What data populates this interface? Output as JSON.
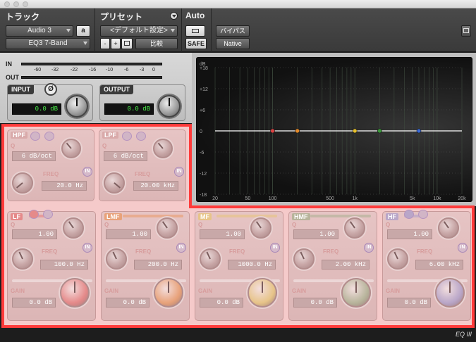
{
  "header": {
    "track_label": "トラック",
    "preset_label": "プリセット",
    "auto_label": "Auto",
    "track_name": "Audio 3",
    "track_variant": "a",
    "plugin_name": "EQ3 7-Band",
    "preset_name": "<デフォルト設定>",
    "minus_label": "-",
    "plus_label": "+",
    "compare_label": "比較",
    "safe_label": "SAFE",
    "bypass_label": "バイパス",
    "native_label": "Native"
  },
  "meters": {
    "in_label": "IN",
    "out_label": "OUT",
    "scale": [
      "-60",
      "-32",
      "-22",
      "-16",
      "-10",
      "-6",
      "-3",
      "0"
    ]
  },
  "input": {
    "label": "INPUT",
    "value": "0.0 dB",
    "phase_label": "Ø"
  },
  "output": {
    "label": "OUTPUT",
    "value": "0.0 dB"
  },
  "graph": {
    "db_label": "dB",
    "y_ticks": [
      "+18",
      "+12",
      "+6",
      "0",
      "-6",
      "-12",
      "-18"
    ],
    "x_ticks": [
      "20",
      "50",
      "100",
      "500",
      "1k",
      "5k",
      "10k",
      "20k"
    ]
  },
  "bands": {
    "hpf": {
      "name": "HPF",
      "q_label": "Q",
      "q_value": "6 dB/oct",
      "freq_label": "FREQ",
      "freq_value": "20.0 Hz",
      "in_label": "IN"
    },
    "lpf": {
      "name": "LPF",
      "q_label": "Q",
      "q_value": "6 dB/oct",
      "freq_label": "FREQ",
      "freq_value": "20.00 kHz",
      "in_label": "IN"
    },
    "lf": {
      "name": "LF",
      "q_label": "Q",
      "q_value": "1.00",
      "freq_label": "FREQ",
      "freq_value": "100.0 Hz",
      "gain_label": "GAIN",
      "gain_value": "0.0 dB",
      "in_label": "IN",
      "color": "#e58a8a"
    },
    "lmf": {
      "name": "LMF",
      "q_label": "Q",
      "q_value": "1.00",
      "freq_label": "FREQ",
      "freq_value": "200.0 Hz",
      "gain_label": "GAIN",
      "gain_value": "0.0 dB",
      "in_label": "IN",
      "color": "#e8a27a"
    },
    "mf": {
      "name": "MF",
      "q_label": "Q",
      "q_value": "1.00",
      "freq_label": "FREQ",
      "freq_value": "1000.0 Hz",
      "gain_label": "GAIN",
      "gain_value": "0.0 dB",
      "in_label": "IN",
      "color": "#e7c489"
    },
    "hmf": {
      "name": "HMF",
      "q_label": "Q",
      "q_value": "1.00",
      "freq_label": "FREQ",
      "freq_value": "2.00 kHz",
      "gain_label": "GAIN",
      "gain_value": "0.0 dB",
      "in_label": "IN",
      "color": "#b7b49b"
    },
    "hf": {
      "name": "HF",
      "q_label": "Q",
      "q_value": "1.00",
      "freq_label": "FREQ",
      "freq_value": "6.00 kHz",
      "gain_label": "GAIN",
      "gain_value": "0.0 dB",
      "in_label": "IN",
      "color": "#b9a6c8"
    }
  },
  "graph_points": [
    {
      "band": "lf",
      "freq": 100,
      "gain": 0,
      "color": "#d94242"
    },
    {
      "band": "lmf",
      "freq": 200,
      "gain": 0,
      "color": "#e38a2a"
    },
    {
      "band": "mf",
      "freq": 1000,
      "gain": 0,
      "color": "#e6c02c"
    },
    {
      "band": "hmf",
      "freq": 2000,
      "gain": 0,
      "color": "#3a9a3a"
    },
    {
      "band": "hf",
      "freq": 6000,
      "gain": 0,
      "color": "#3a6ad8"
    }
  ],
  "footer": {
    "logo": "EQ III"
  }
}
